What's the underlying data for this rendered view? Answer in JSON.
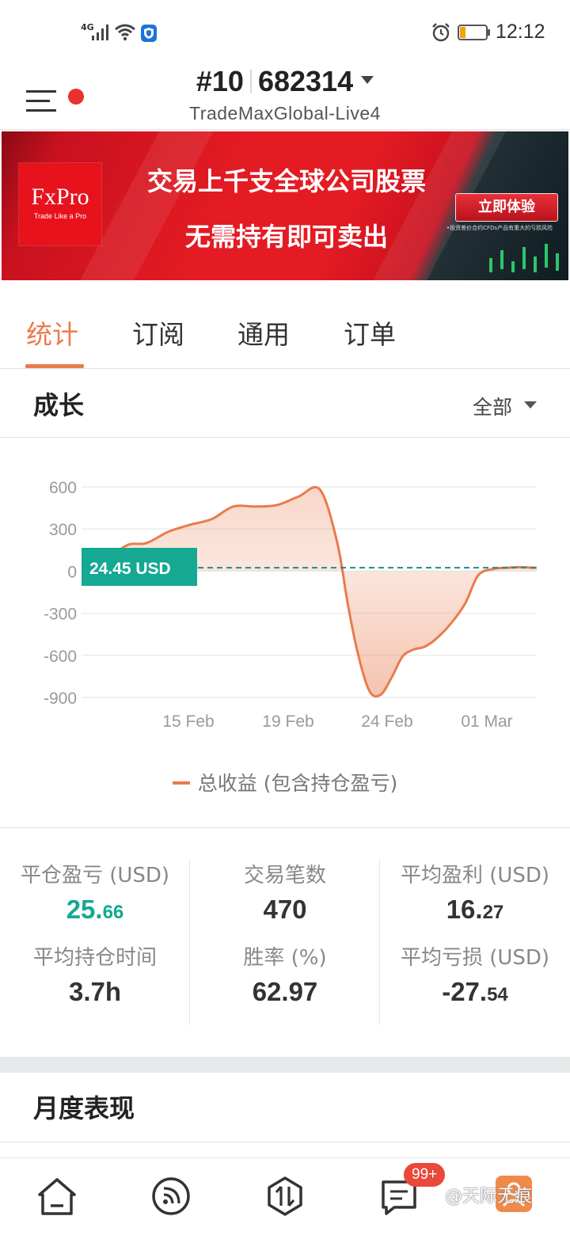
{
  "status_bar": {
    "network": "4G",
    "time": "12:12",
    "battery_level": 0.2
  },
  "header": {
    "account_prefix": "#10",
    "account_number": "682314",
    "server": "TradeMaxGlobal-Live4"
  },
  "banner": {
    "logo_name": "FxPro",
    "logo_tagline": "Trade Like a Pro",
    "line1": "交易上千支全球公司股票",
    "line2": "无需持有即可卖出",
    "cta": "立即体验",
    "note": "•投资差价合约CFDs产品有重大的亏损风险"
  },
  "tabs": [
    {
      "label": "统计",
      "active": true
    },
    {
      "label": "订阅",
      "active": false
    },
    {
      "label": "通用",
      "active": false
    },
    {
      "label": "订单",
      "active": false
    }
  ],
  "growth": {
    "title": "成长",
    "filter": "全部"
  },
  "chart_data": {
    "type": "area",
    "xlabel": "",
    "ylabel": "",
    "ylim": [
      -900,
      600
    ],
    "yticks": [
      "600",
      "300",
      "0",
      "-300",
      "-600",
      "-900"
    ],
    "ytick_values": [
      600,
      300,
      0,
      -300,
      -600,
      -900
    ],
    "xticks": [
      "15 Feb",
      "19 Feb",
      "24 Feb",
      "01 Mar"
    ],
    "current_value_label": "24.45 USD",
    "current_value": 24.45,
    "series": [
      {
        "name": "总收益 (包含持仓盈亏)",
        "color": "#ea7b4d",
        "x_day": [
          11.0,
          11.5,
          12.5,
          13.2,
          14.0,
          15.0,
          16.0,
          17.0,
          18.0,
          19.0,
          20.0,
          21.0,
          22.0,
          22.8,
          23.3,
          23.8,
          24.3,
          24.8,
          25.3,
          25.8,
          26.3,
          26.8,
          27.3,
          28.0,
          28.7,
          29.3,
          30.0,
          30.7,
          31.3,
          31.8,
          32.0
        ],
        "values": [
          40,
          70,
          130,
          190,
          200,
          280,
          330,
          370,
          460,
          460,
          470,
          530,
          580,
          200,
          -250,
          -620,
          -860,
          -880,
          -760,
          -610,
          -560,
          -540,
          -490,
          -380,
          -230,
          -30,
          15,
          25,
          28,
          24,
          24
        ]
      }
    ]
  },
  "stats": [
    {
      "label": "平仓盈亏 (USD)",
      "int": "25.",
      "dec": "66",
      "green": true
    },
    {
      "label": "交易笔数",
      "int": "470",
      "dec": "",
      "green": false
    },
    {
      "label": "平均盈利 (USD)",
      "int": "16.",
      "dec": "27",
      "green": false
    },
    {
      "label": "平均持仓时间",
      "int": "3.7h",
      "dec": "",
      "green": false
    },
    {
      "label": "胜率 (%)",
      "int": "62.97",
      "dec": "",
      "green": false
    },
    {
      "label": "平均亏损 (USD)",
      "int": "-27.",
      "dec": "54",
      "green": false
    }
  ],
  "monthly": {
    "title": "月度表现"
  },
  "bottom_nav": {
    "items": [
      "home-icon",
      "feed-icon",
      "trade-icon",
      "messages-icon",
      "me-icon"
    ],
    "badge": "99+",
    "watermark": "@天际无痕"
  }
}
